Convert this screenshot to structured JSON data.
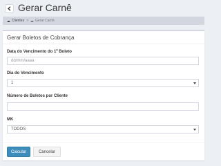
{
  "header": {
    "title": "Gerar Carnê",
    "back_icon": "chevron-left-icon"
  },
  "breadcrumb": {
    "items": [
      {
        "label": "Clientes",
        "icon": "dashboard-icon"
      },
      {
        "label": "Gerar Carnê",
        "icon": "dashboard-icon"
      }
    ],
    "separator": ">"
  },
  "form": {
    "title": "Gerar Boletos de Cobrança",
    "fields": {
      "first_due_date": {
        "label": "Data do Vencimento do 1º Boleto",
        "placeholder": "dd/mm/aaaa",
        "value": ""
      },
      "due_day": {
        "label": "Dia do Vencimento",
        "value": "1"
      },
      "boletos_per_client": {
        "label": "Número de Boletos por Cliente",
        "value": ""
      },
      "mk": {
        "label": "MK",
        "value": "TODOS"
      }
    },
    "buttons": {
      "submit": "Calcular",
      "cancel": "Cancelar"
    }
  },
  "colors": {
    "background": "#ecf0f5",
    "primary": "#3c8dbc",
    "breadcrumb_bg": "#d2d6de"
  }
}
